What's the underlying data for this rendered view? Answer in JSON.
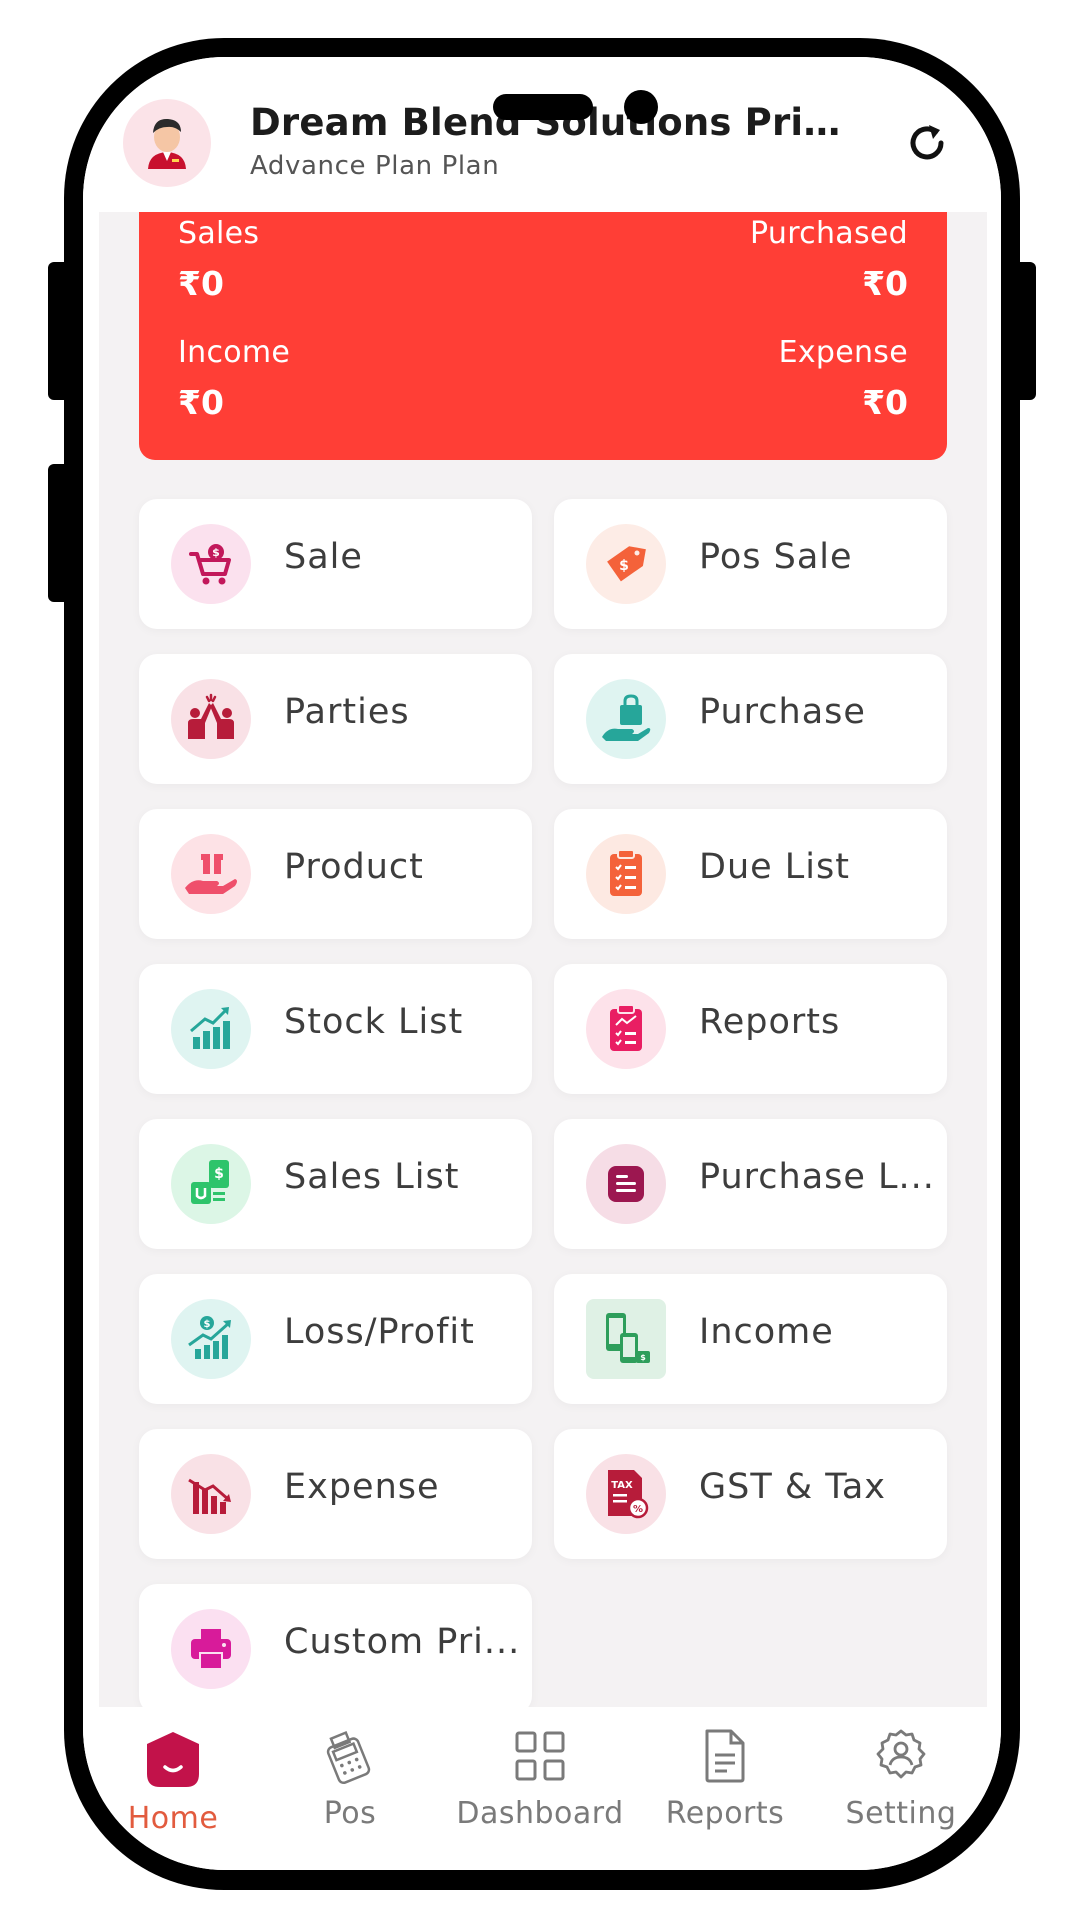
{
  "header": {
    "company_name": "Dream Blend Solutions Privat...",
    "plan": "Advance Plan Plan",
    "avatar_icon": "user-avatar-icon",
    "refresh_icon": "refresh-icon"
  },
  "summary": {
    "sales_label": "Sales",
    "sales_value": "₹0",
    "purchased_label": "Purchased",
    "purchased_value": "₹0",
    "income_label": "Income",
    "income_value": "₹0",
    "expense_label": "Expense",
    "expense_value": "₹0",
    "background_color": "#ff3e36"
  },
  "menu": [
    {
      "label": "Sale",
      "icon": "shopping-cart-icon",
      "color": "#c2185b"
    },
    {
      "label": "Pos Sale",
      "icon": "price-tag-icon",
      "color": "#f4623a"
    },
    {
      "label": "Parties",
      "icon": "high-five-icon",
      "color": "#b71c3a"
    },
    {
      "label": "Purchase",
      "icon": "shopping-bag-hand-icon",
      "color": "#26a69a"
    },
    {
      "label": "Product",
      "icon": "gift-hand-icon",
      "color": "#ef4f6b"
    },
    {
      "label": "Due List",
      "icon": "clipboard-checklist-icon",
      "color": "#f4623a"
    },
    {
      "label": "Stock List",
      "icon": "bar-chart-growth-icon",
      "color": "#26a69a"
    },
    {
      "label": "Reports",
      "icon": "report-clipboard-icon",
      "color": "#e91e63"
    },
    {
      "label": "Sales List",
      "icon": "money-receipt-icon",
      "color": "#2ec46b"
    },
    {
      "label": "Purchase L...",
      "icon": "purchase-list-icon",
      "color": "#9c1750"
    },
    {
      "label": "Loss/Profit",
      "icon": "profit-chart-icon",
      "color": "#26a69a"
    },
    {
      "label": "Income",
      "icon": "mobile-income-icon",
      "color": "#2e9e5b"
    },
    {
      "label": "Expense",
      "icon": "expense-down-chart-icon",
      "color": "#b71c3a"
    },
    {
      "label": "GST & Tax",
      "icon": "tax-document-icon",
      "color": "#b71c3a"
    },
    {
      "label": "Custom Pri...",
      "icon": "printer-icon",
      "color": "#d81b9a"
    }
  ],
  "bottom_nav": [
    {
      "label": "Home",
      "icon": "home-icon",
      "active": true
    },
    {
      "label": "Pos",
      "icon": "pos-terminal-icon",
      "active": false
    },
    {
      "label": "Dashboard",
      "icon": "dashboard-grid-icon",
      "active": false
    },
    {
      "label": "Reports",
      "icon": "document-icon",
      "active": false
    },
    {
      "label": "Setting",
      "icon": "gear-user-icon",
      "active": false
    }
  ]
}
